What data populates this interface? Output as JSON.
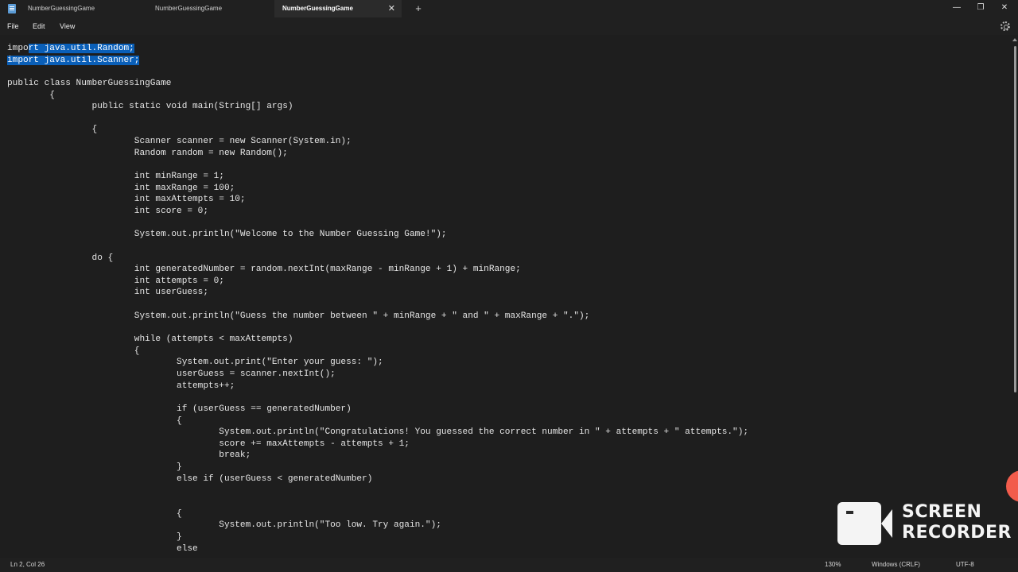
{
  "window": {
    "tabs": [
      {
        "label": "NumberGuessingGame",
        "active": false
      },
      {
        "label": "NumberGuessingGame",
        "active": false
      },
      {
        "label": "NumberGuessingGame",
        "active": true
      }
    ],
    "close_tab_glyph": "✕",
    "new_tab_glyph": "+",
    "minimize_glyph": "—",
    "maximize_glyph": "❐",
    "close_glyph": "✕"
  },
  "menu": {
    "file": "File",
    "edit": "Edit",
    "view": "View",
    "settings_icon": "gear-icon"
  },
  "editor": {
    "lines": [
      {
        "before": "impo",
        "selected": "rt java.util.Random;",
        "after": ""
      },
      {
        "before": "",
        "selected": "import java.util.Scanner;",
        "after": ""
      },
      {
        "before": "",
        "selected": "",
        "after": ""
      },
      {
        "before": "public class NumberGuessingGame",
        "selected": "",
        "after": ""
      },
      {
        "before": "\t{",
        "selected": "",
        "after": ""
      },
      {
        "before": "\t\tpublic static void main(String[] args)",
        "selected": "",
        "after": ""
      },
      {
        "before": "",
        "selected": "",
        "after": ""
      },
      {
        "before": "\t\t{",
        "selected": "",
        "after": ""
      },
      {
        "before": "\t\t\tScanner scanner = new Scanner(System.in);",
        "selected": "",
        "after": ""
      },
      {
        "before": "\t\t\tRandom random = new Random();",
        "selected": "",
        "after": ""
      },
      {
        "before": "",
        "selected": "",
        "after": ""
      },
      {
        "before": "\t\t\tint minRange = 1;",
        "selected": "",
        "after": ""
      },
      {
        "before": "\t\t\tint maxRange = 100;",
        "selected": "",
        "after": ""
      },
      {
        "before": "\t\t\tint maxAttempts = 10;",
        "selected": "",
        "after": ""
      },
      {
        "before": "\t\t\tint score = 0;",
        "selected": "",
        "after": ""
      },
      {
        "before": "",
        "selected": "",
        "after": ""
      },
      {
        "before": "\t\t\tSystem.out.println(\"Welcome to the Number Guessing Game!\");",
        "selected": "",
        "after": ""
      },
      {
        "before": "",
        "selected": "",
        "after": ""
      },
      {
        "before": "\t\tdo {",
        "selected": "",
        "after": ""
      },
      {
        "before": "\t\t\tint generatedNumber = random.nextInt(maxRange - minRange + 1) + minRange;",
        "selected": "",
        "after": ""
      },
      {
        "before": "\t\t\tint attempts = 0;",
        "selected": "",
        "after": ""
      },
      {
        "before": "\t\t\tint userGuess;",
        "selected": "",
        "after": ""
      },
      {
        "before": "",
        "selected": "",
        "after": ""
      },
      {
        "before": "\t\t\tSystem.out.println(\"Guess the number between \" + minRange + \" and \" + maxRange + \".\");",
        "selected": "",
        "after": ""
      },
      {
        "before": "",
        "selected": "",
        "after": ""
      },
      {
        "before": "\t\t\twhile (attempts < maxAttempts)",
        "selected": "",
        "after": ""
      },
      {
        "before": "\t\t\t{",
        "selected": "",
        "after": ""
      },
      {
        "before": "\t\t\t\tSystem.out.print(\"Enter your guess: \");",
        "selected": "",
        "after": ""
      },
      {
        "before": "\t\t\t\tuserGuess = scanner.nextInt();",
        "selected": "",
        "after": ""
      },
      {
        "before": "\t\t\t\tattempts++;",
        "selected": "",
        "after": ""
      },
      {
        "before": "",
        "selected": "",
        "after": ""
      },
      {
        "before": "\t\t\t\tif (userGuess == generatedNumber)",
        "selected": "",
        "after": ""
      },
      {
        "before": "\t\t\t\t{",
        "selected": "",
        "after": ""
      },
      {
        "before": "\t\t\t\t\tSystem.out.println(\"Congratulations! You guessed the correct number in \" + attempts + \" attempts.\");",
        "selected": "",
        "after": ""
      },
      {
        "before": "\t\t\t\t\tscore += maxAttempts - attempts + 1;",
        "selected": "",
        "after": ""
      },
      {
        "before": "\t\t\t\t\tbreak;",
        "selected": "",
        "after": ""
      },
      {
        "before": "\t\t\t\t}",
        "selected": "",
        "after": ""
      },
      {
        "before": "\t\t\t\telse if (userGuess < generatedNumber)",
        "selected": "",
        "after": ""
      },
      {
        "before": "",
        "selected": "",
        "after": ""
      },
      {
        "before": "",
        "selected": "",
        "after": ""
      },
      {
        "before": "\t\t\t\t{",
        "selected": "",
        "after": ""
      },
      {
        "before": "\t\t\t\t\tSystem.out.println(\"Too low. Try again.\");",
        "selected": "",
        "after": ""
      },
      {
        "before": "\t\t\t\t}",
        "selected": "",
        "after": ""
      },
      {
        "before": "\t\t\t\telse",
        "selected": "",
        "after": ""
      }
    ]
  },
  "status": {
    "position": "Ln 2, Col 26",
    "zoom": "130%",
    "line_ending": "Windows (CRLF)",
    "encoding": "UTF-8"
  },
  "watermark": {
    "line1": "SCREEN",
    "line2": "RECORDER",
    "icon": "video-camera-icon"
  },
  "colors": {
    "background": "#1e1e1e",
    "chrome": "#202020",
    "selection": "#0a5fb8",
    "text": "#e6e6e6"
  }
}
